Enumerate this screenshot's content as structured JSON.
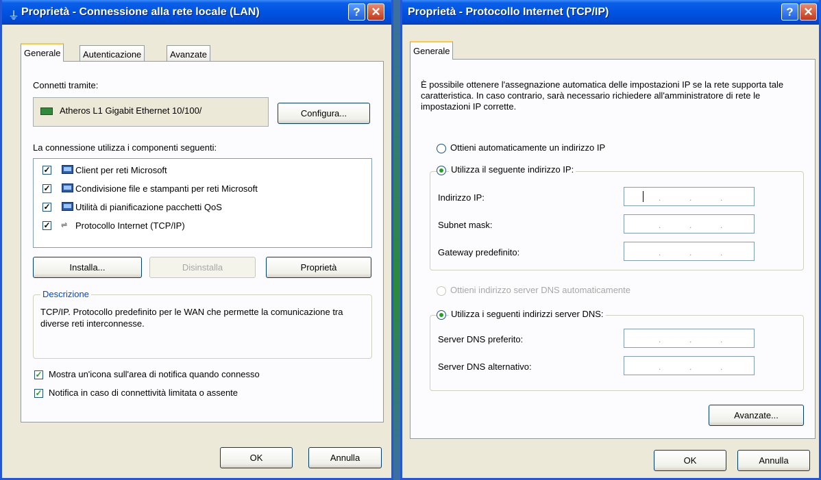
{
  "lan_dialog": {
    "title": "Proprietà - Connessione alla rete locale (LAN)",
    "tabs": [
      "Generale",
      "Autenticazione",
      "Avanzate"
    ],
    "connect_via_label": "Connetti tramite:",
    "adapter_name": "Atheros L1 Gigabit Ethernet 10/100/",
    "configure_button": "Configura...",
    "components_label": "La connessione utilizza i componenti seguenti:",
    "components": [
      {
        "label": "Client per reti Microsoft",
        "checked": true
      },
      {
        "label": "Condivisione file e stampanti per reti Microsoft",
        "checked": true
      },
      {
        "label": "Utilità di pianificazione pacchetti QoS",
        "checked": true
      },
      {
        "label": "Protocollo Internet (TCP/IP)",
        "checked": true
      }
    ],
    "install_button": "Installa...",
    "uninstall_button": "Disinstalla",
    "properties_button": "Proprietà",
    "description_legend": "Descrizione",
    "description_text": "TCP/IP. Protocollo predefinito per le WAN che permette la comunicazione tra diverse reti interconnesse.",
    "show_icon_label": "Mostra un'icona sull'area di notifica quando connesso",
    "notify_label": "Notifica in caso di connettività limitata o assente",
    "ok_button": "OK",
    "cancel_button": "Annulla"
  },
  "tcpip_dialog": {
    "title": "Proprietà - Protocollo Internet (TCP/IP)",
    "tab": "Generale",
    "intro_text": "È possibile ottenere l'assegnazione automatica delle impostazioni IP se la rete supporta tale caratteristica. In caso contrario, sarà necessario richiedere all'amministratore di rete le impostazioni IP corrette.",
    "auto_ip_label": "Ottieni automaticamente un indirizzo IP",
    "manual_ip_label": "Utilizza il seguente indirizzo IP:",
    "ip_label": "Indirizzo IP:",
    "subnet_label": "Subnet mask:",
    "gateway_label": "Gateway predefinito:",
    "auto_dns_label": "Ottieni indirizzo server DNS automaticamente",
    "manual_dns_label": "Utilizza i seguenti indirizzi server DNS:",
    "preferred_dns_label": "Server DNS preferito:",
    "alternate_dns_label": "Server DNS alternativo:",
    "advanced_button": "Avanzate...",
    "ok_button": "OK",
    "cancel_button": "Annulla"
  },
  "icons": {
    "title_help": "?",
    "title_close": "✕",
    "checkmark": "✓"
  },
  "colors": {
    "titlebar": "#0053e1",
    "dialog_bg": "#ece9d8",
    "radio_check": "#21a121"
  }
}
